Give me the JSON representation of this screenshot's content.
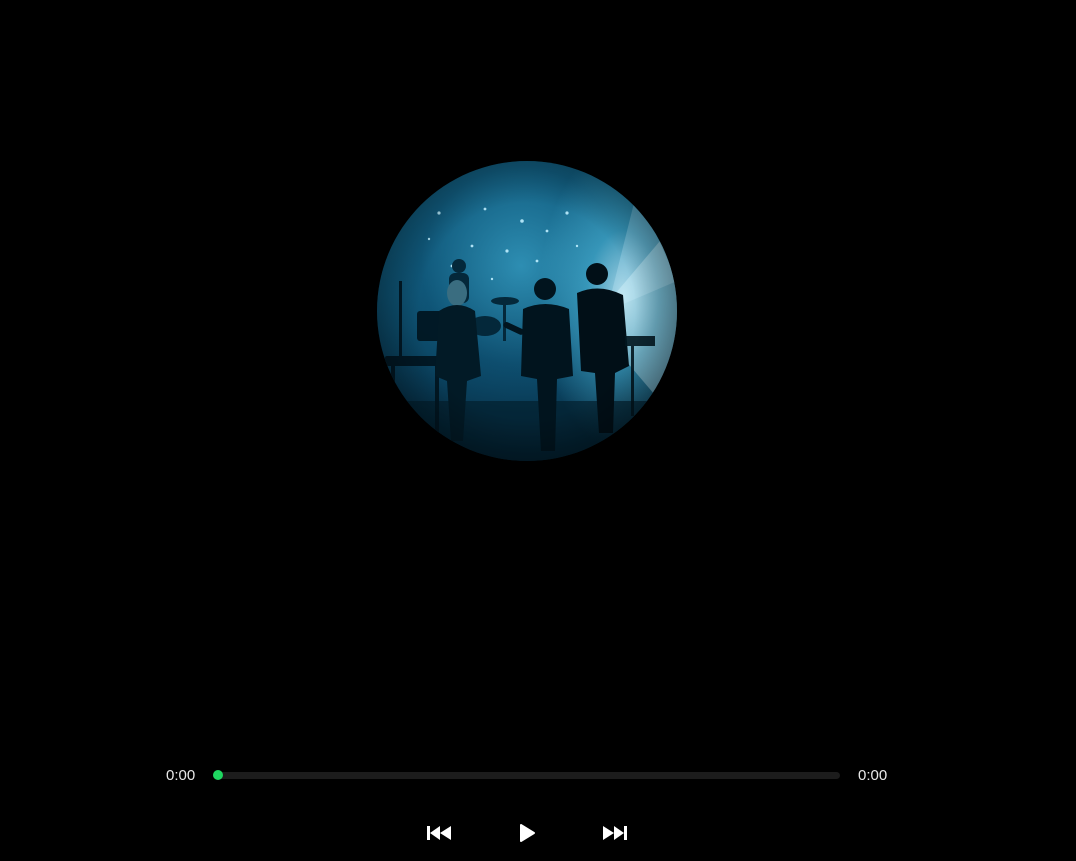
{
  "player": {
    "current_time": "0:00",
    "total_time": "0:00",
    "progress_fraction": 0,
    "accent_color": "#1db954"
  },
  "album_art": {
    "shape": "circle",
    "description_icon": "concert-stage-photo"
  },
  "controls": {
    "previous_icon": "skip-back-icon",
    "play_icon": "play-icon",
    "next_icon": "skip-forward-icon"
  }
}
